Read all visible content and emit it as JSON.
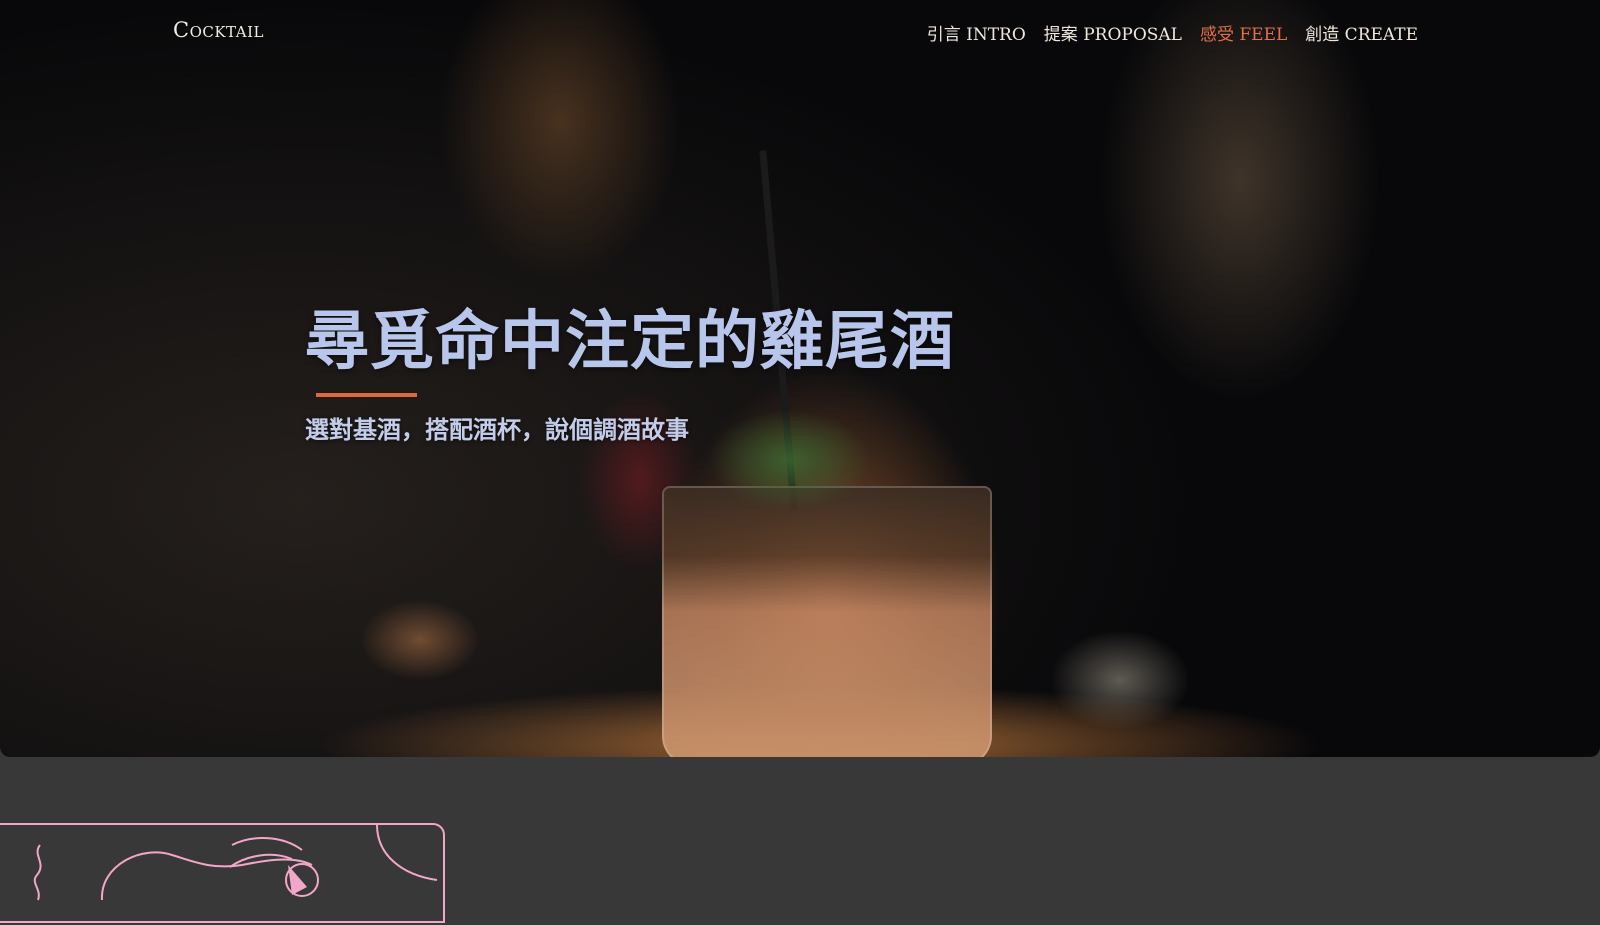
{
  "brand": "Cocktail",
  "nav": {
    "items": [
      {
        "label": "引言 INTRO",
        "active": false
      },
      {
        "label": "提案 PROPOSAL",
        "active": false
      },
      {
        "label": "感受 FEEL",
        "active": true
      },
      {
        "label": "創造 CREATE",
        "active": false
      }
    ]
  },
  "hero": {
    "title": "尋覓命中注定的雞尾酒",
    "subtitle": "選對基酒，搭配酒杯，說個調酒故事"
  },
  "colors": {
    "accent": "#e0683f",
    "title": "#b7c6ea",
    "background": "#383838",
    "illustration_line": "#f2a6c8"
  }
}
